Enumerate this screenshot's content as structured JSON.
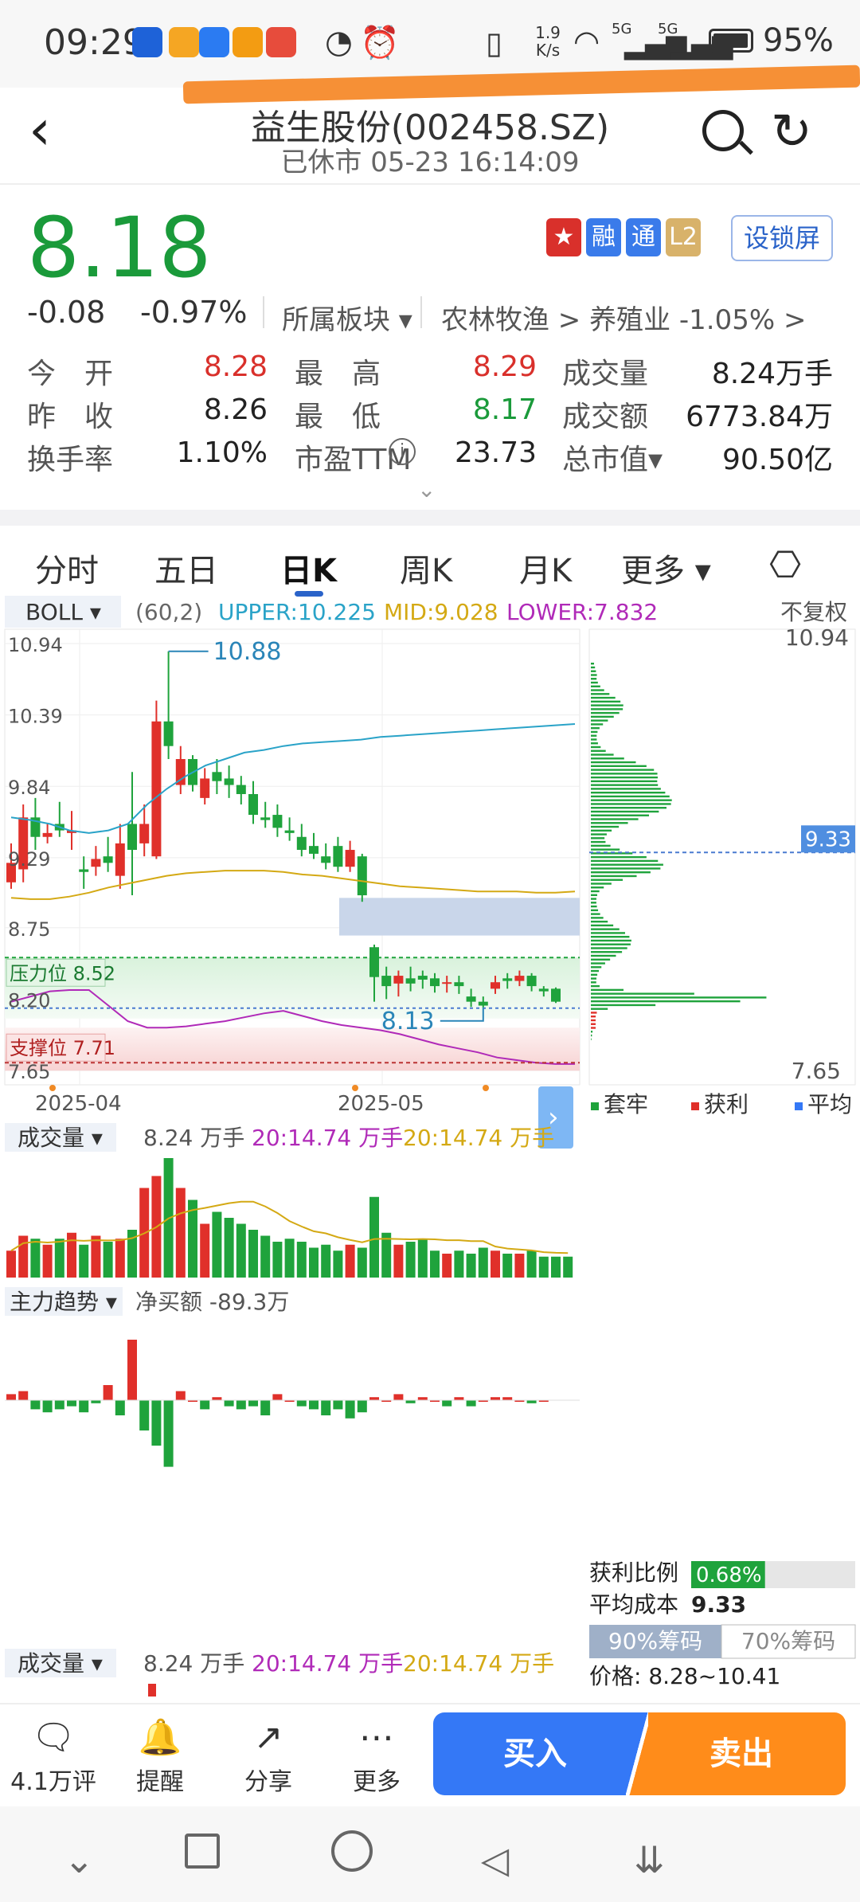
{
  "status_bar": {
    "time": "09:29",
    "net_speed": "1.9 K/s",
    "signal1": "5G",
    "signal2": "5G",
    "battery": "95%"
  },
  "header": {
    "title": "益生股份(002458.SZ)",
    "subtitle": "已休市 05-23 16:14:09",
    "back_icon": "chevron-left-icon",
    "search_icon": "search-icon",
    "refresh_icon": "refresh-icon"
  },
  "quote": {
    "price": "8.18",
    "change": "-0.08",
    "change_pct": "-0.97%",
    "sector_label": "所属板块",
    "sector_path": "农林牧渔 > 养殖业 -1.05% >",
    "badges": [
      "融",
      "通",
      "L2"
    ],
    "lock_button": "设锁屏",
    "stats": [
      {
        "label": "今　开",
        "value": "8.28",
        "color": "red"
      },
      {
        "label": "最　高",
        "value": "8.29",
        "color": "red"
      },
      {
        "label": "成交量",
        "value": "8.24万手",
        "color": "normal"
      },
      {
        "label": "昨　收",
        "value": "8.26",
        "color": "normal"
      },
      {
        "label": "最　低",
        "value": "8.17",
        "color": "green"
      },
      {
        "label": "成交额",
        "value": "6773.84万",
        "color": "normal"
      },
      {
        "label": "换手率",
        "value": "1.10%",
        "color": "normal"
      },
      {
        "label": "市盈TTM",
        "value": "23.73",
        "color": "normal"
      },
      {
        "label": "总市值▾",
        "value": "90.50亿",
        "color": "normal"
      }
    ]
  },
  "tabs": [
    "分时",
    "五日",
    "日K",
    "周K",
    "月K",
    "更多 ▾"
  ],
  "active_tab": "日K",
  "boll": {
    "indicator": "BOLL ▾",
    "params": "(60,2)",
    "upper": "UPPER:10.225",
    "mid": "MID:9.028",
    "lower": "LOWER:7.832",
    "adjust": "不复权"
  },
  "colors": {
    "up": "#e0302a",
    "down": "#1fa33c",
    "upper_line": "#2aa3c8",
    "mid_line": "#d4a914",
    "lower_line": "#b02ab8",
    "accent_blue": "#3478f6",
    "accent_orange": "#ff8c1a"
  },
  "chart_data": {
    "type": "candlestick",
    "title": "",
    "ylim": [
      7.65,
      10.94
    ],
    "y_ticks": [
      "10.94",
      "10.39",
      "9.84",
      "9.29",
      "8.75",
      "8.20",
      "7.65"
    ],
    "right_y_ticks": [
      "10.94",
      "7.65"
    ],
    "x_ticks": [
      "2025-04",
      "2025-05"
    ],
    "max_label": "10.88",
    "min_label": "8.13",
    "avg_cost_tag": "9.33",
    "pressure_label": "压力位 8.52",
    "pressure_value": 8.52,
    "support_label": "支撑位 7.71",
    "support_value": 7.71,
    "gap_zone": [
      8.69,
      8.98
    ],
    "candles": [
      {
        "o": 9.1,
        "c": 9.25,
        "h": 9.4,
        "l": 9.05
      },
      {
        "o": 9.2,
        "c": 9.6,
        "h": 9.7,
        "l": 9.1
      },
      {
        "o": 9.6,
        "c": 9.45,
        "h": 9.75,
        "l": 9.35
      },
      {
        "o": 9.45,
        "c": 9.48,
        "h": 9.55,
        "l": 9.4
      },
      {
        "o": 9.55,
        "c": 9.5,
        "h": 9.72,
        "l": 9.45
      },
      {
        "o": 9.48,
        "c": 9.5,
        "h": 9.65,
        "l": 9.35
      },
      {
        "o": 9.2,
        "c": 9.18,
        "h": 9.3,
        "l": 9.05
      },
      {
        "o": 9.22,
        "c": 9.28,
        "h": 9.38,
        "l": 9.15
      },
      {
        "o": 9.3,
        "c": 9.25,
        "h": 9.45,
        "l": 9.18
      },
      {
        "o": 9.15,
        "c": 9.4,
        "h": 9.55,
        "l": 9.05
      },
      {
        "o": 9.55,
        "c": 9.35,
        "h": 9.95,
        "l": 9.0
      },
      {
        "o": 9.4,
        "c": 9.55,
        "h": 9.7,
        "l": 9.3
      },
      {
        "o": 9.3,
        "c": 10.34,
        "h": 10.5,
        "l": 9.28
      },
      {
        "o": 10.34,
        "c": 10.15,
        "h": 10.88,
        "l": 10.05
      },
      {
        "o": 9.85,
        "c": 10.05,
        "h": 10.15,
        "l": 9.78
      },
      {
        "o": 10.05,
        "c": 9.85,
        "h": 10.08,
        "l": 9.8
      },
      {
        "o": 9.75,
        "c": 9.9,
        "h": 9.98,
        "l": 9.7
      },
      {
        "o": 9.95,
        "c": 9.88,
        "h": 10.05,
        "l": 9.78
      },
      {
        "o": 9.9,
        "c": 9.85,
        "h": 10.0,
        "l": 9.75
      },
      {
        "o": 9.85,
        "c": 9.78,
        "h": 9.92,
        "l": 9.7
      },
      {
        "o": 9.78,
        "c": 9.62,
        "h": 9.88,
        "l": 9.55
      },
      {
        "o": 9.6,
        "c": 9.58,
        "h": 9.72,
        "l": 9.52
      },
      {
        "o": 9.62,
        "c": 9.52,
        "h": 9.7,
        "l": 9.45
      },
      {
        "o": 9.5,
        "c": 9.48,
        "h": 9.6,
        "l": 9.42
      },
      {
        "o": 9.45,
        "c": 9.35,
        "h": 9.55,
        "l": 9.3
      },
      {
        "o": 9.38,
        "c": 9.32,
        "h": 9.48,
        "l": 9.28
      },
      {
        "o": 9.3,
        "c": 9.25,
        "h": 9.4,
        "l": 9.2
      },
      {
        "o": 9.38,
        "c": 9.22,
        "h": 9.45,
        "l": 9.18
      },
      {
        "o": 9.22,
        "c": 9.35,
        "h": 9.42,
        "l": 9.18
      },
      {
        "o": 9.3,
        "c": 9.0,
        "h": 9.32,
        "l": 8.95
      },
      {
        "o": 8.6,
        "c": 8.37,
        "h": 8.62,
        "l": 8.18
      },
      {
        "o": 8.38,
        "c": 8.3,
        "h": 8.45,
        "l": 8.2
      },
      {
        "o": 8.32,
        "c": 8.38,
        "h": 8.42,
        "l": 8.22
      },
      {
        "o": 8.36,
        "c": 8.32,
        "h": 8.45,
        "l": 8.26
      },
      {
        "o": 8.38,
        "c": 8.35,
        "h": 8.42,
        "l": 8.28
      },
      {
        "o": 8.36,
        "c": 8.3,
        "h": 8.4,
        "l": 8.25
      },
      {
        "o": 8.32,
        "c": 8.33,
        "h": 8.38,
        "l": 8.25
      },
      {
        "o": 8.33,
        "c": 8.3,
        "h": 8.38,
        "l": 8.24
      },
      {
        "o": 8.22,
        "c": 8.18,
        "h": 8.28,
        "l": 8.14
      },
      {
        "o": 8.18,
        "c": 8.15,
        "h": 8.22,
        "l": 8.13
      },
      {
        "o": 8.28,
        "c": 8.33,
        "h": 8.38,
        "l": 8.24
      },
      {
        "o": 8.36,
        "c": 8.34,
        "h": 8.4,
        "l": 8.28
      },
      {
        "o": 8.34,
        "c": 8.38,
        "h": 8.42,
        "l": 8.3
      },
      {
        "o": 8.38,
        "c": 8.3,
        "h": 8.4,
        "l": 8.26
      },
      {
        "o": 8.28,
        "c": 8.26,
        "h": 8.3,
        "l": 8.22
      },
      {
        "o": 8.28,
        "c": 8.18,
        "h": 8.29,
        "l": 8.17
      }
    ],
    "series": [
      {
        "name": "UPPER",
        "values": [
          9.6,
          9.58,
          9.55,
          9.5,
          9.48,
          9.5,
          9.55,
          9.7,
          9.82,
          9.92,
          10.0,
          10.05,
          10.1,
          10.12,
          10.15,
          10.17,
          10.18,
          10.19,
          10.2,
          10.22,
          10.23,
          10.24,
          10.25,
          10.26,
          10.27,
          10.28,
          10.29,
          10.3,
          10.31,
          10.32
        ]
      },
      {
        "name": "MID",
        "values": [
          8.98,
          8.97,
          8.97,
          8.99,
          9.02,
          9.06,
          9.09,
          9.12,
          9.15,
          9.17,
          9.18,
          9.19,
          9.19,
          9.19,
          9.18,
          9.16,
          9.15,
          9.13,
          9.11,
          9.09,
          9.07,
          9.06,
          9.05,
          9.04,
          9.03,
          9.03,
          9.03,
          9.02,
          9.02,
          9.03
        ]
      },
      {
        "name": "LOWER",
        "values": [
          8.18,
          8.22,
          8.26,
          8.27,
          8.27,
          8.15,
          8.03,
          7.98,
          7.98,
          7.99,
          8.01,
          8.03,
          8.06,
          8.09,
          8.11,
          8.07,
          8.03,
          8.0,
          7.98,
          7.96,
          7.93,
          7.89,
          7.85,
          7.82,
          7.79,
          7.75,
          7.73,
          7.71,
          7.7,
          7.7
        ]
      }
    ],
    "volume": {
      "label": "成交量 ▾",
      "value": "8.24 万手",
      "ma1_label": "20:14.74 万手",
      "ma2_label": "20:14.74 万手",
      "bars": [
        9,
        14,
        13,
        11,
        13,
        15,
        11,
        14,
        12,
        13,
        16,
        30,
        34,
        40,
        30,
        26,
        18,
        22,
        20,
        18,
        16,
        14,
        12,
        13,
        12,
        10,
        11,
        9,
        11,
        10,
        27,
        15,
        11,
        12,
        13,
        9,
        8,
        9,
        8,
        10,
        9,
        8,
        8,
        9,
        7,
        7,
        7
      ]
    },
    "main_force": {
      "label": "主力趋势 ▾",
      "net_label": "净买额 -89.3万",
      "bars": [
        2,
        3,
        -3,
        -4,
        -3,
        -2,
        -4,
        -1,
        5,
        -5,
        20,
        -10,
        -15,
        -22,
        3,
        0,
        -3,
        1,
        -2,
        -3,
        -2,
        -5,
        2,
        0,
        -2,
        -3,
        -5,
        -3,
        -6,
        -4,
        1,
        0,
        2,
        -1,
        1,
        0,
        -2,
        1,
        -2,
        0,
        1,
        1,
        0,
        -1,
        0
      ]
    },
    "chip_profile": {
      "legend": [
        "套牢",
        "获利",
        "平均"
      ],
      "profit_ratio_label": "获利比例",
      "profit_ratio": "0.68%",
      "profit_ratio_value": 0.0068,
      "avg_cost_label": "平均成本",
      "avg_cost": "9.33",
      "btn_90": "90%筹码",
      "btn_70": "70%筹码",
      "price_range": "价格: 8.28~10.41"
    },
    "volume2": {
      "label": "成交量 ▾",
      "value": "8.24 万手",
      "ma1_label": "20:14.74 万手",
      "ma2_label": "20:14.74 万手"
    }
  },
  "bottom_bar": {
    "items": [
      {
        "label": "4.1万评",
        "icon": "comment-icon"
      },
      {
        "label": "提醒",
        "icon": "bell-icon"
      },
      {
        "label": "分享",
        "icon": "share-icon"
      },
      {
        "label": "更多",
        "icon": "more-dots-icon"
      }
    ],
    "buy": "买入",
    "sell": "卖出"
  }
}
